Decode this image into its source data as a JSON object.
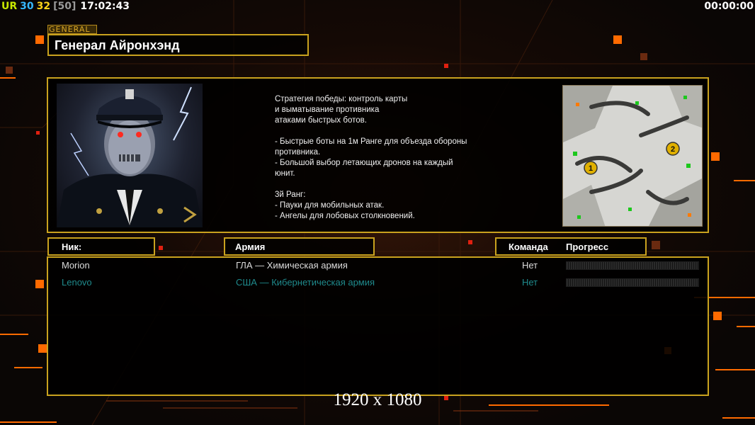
{
  "hud": {
    "rank": "UR",
    "num1": "30",
    "num2": "32",
    "bracket": "[50]",
    "clock": "17:02:43",
    "timer": "00:00:00"
  },
  "general": {
    "tag": "GENERAL",
    "name": "Генерал Айронхэнд",
    "strategy": "Стратегия победы: контроль карты\nи выматывание противника\nатаками быстрых ботов.\n\n- Быстрые боты на 1м Ранге для объезда обороны\n  противника.\n- Большой выбор летающих дронов на каждый\n  юнит.\n\n3й Ранг:\n- Пауки для мобильных атак.\n- Ангелы для лобовых столкновений.",
    "minimap_markers": [
      "1",
      "2"
    ]
  },
  "headers": {
    "nick": "Ник:",
    "army": "Армия",
    "team": "Команда",
    "progress": "Прогресс"
  },
  "players": [
    {
      "nick": "Morion",
      "army": "ГЛА — Химическая армия",
      "team": "Нет",
      "progress": 0,
      "color": "#dcdcdc"
    },
    {
      "nick": "Lenovo",
      "army": "США — Кибернетическая армия",
      "team": "Нет",
      "progress": 0,
      "color": "#1f8a8c"
    }
  ],
  "footer": {
    "resolution": "1920 x 1080"
  },
  "colors": {
    "frame_gold": "#c9a21e",
    "accent_orange": "#ff6a00"
  }
}
